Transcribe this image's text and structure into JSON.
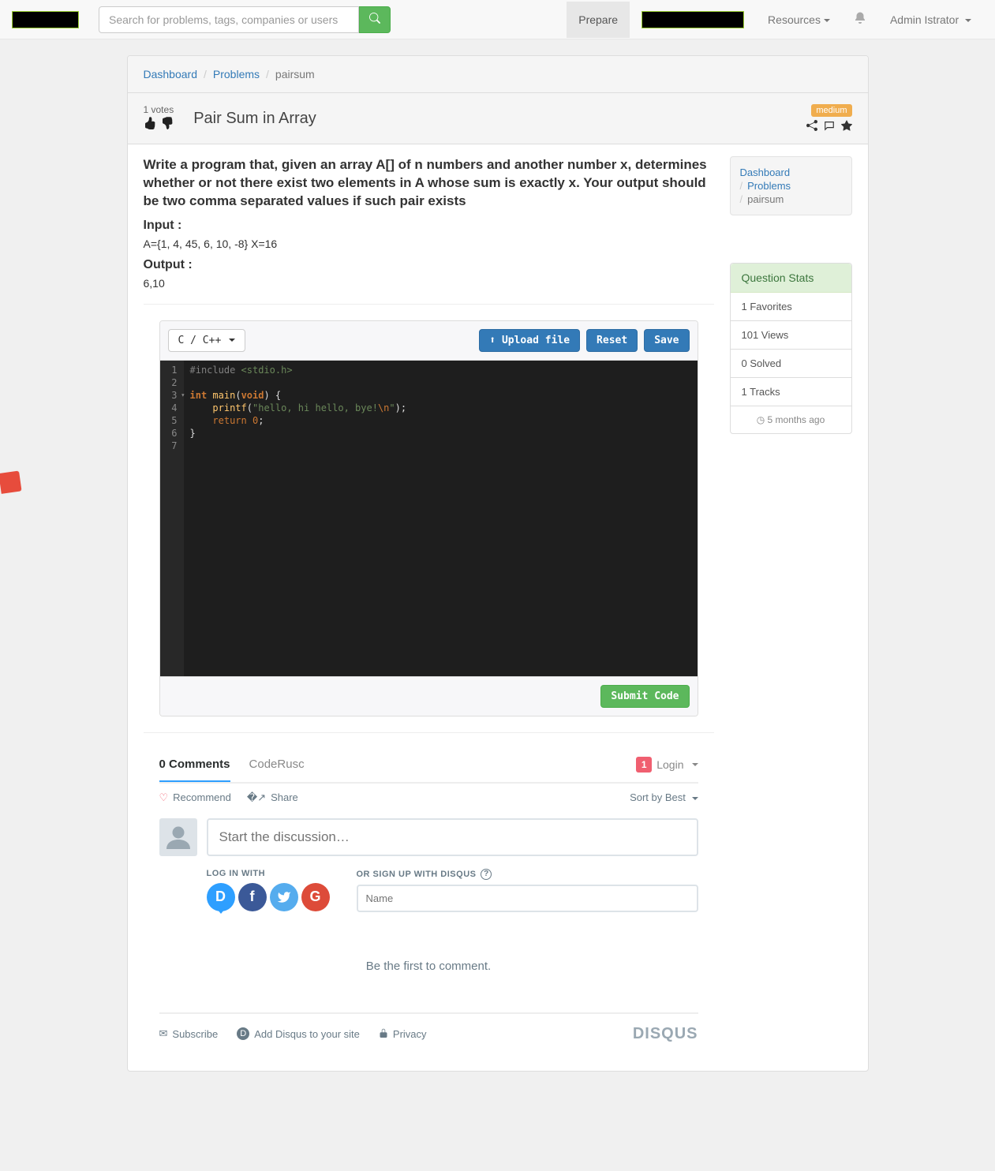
{
  "header": {
    "search_placeholder": "Search for problems, tags, companies or users",
    "nav_prepare": "Prepare",
    "nav_resources": "Resources",
    "nav_user": "Admin Istrator"
  },
  "breadcrumb": {
    "dashboard": "Dashboard",
    "problems": "Problems",
    "current": "pairsum"
  },
  "title": {
    "votes": "1 votes",
    "text": "Pair Sum in Array",
    "difficulty": "medium"
  },
  "problem": {
    "description": "Write a program that, given an array A[] of n numbers and another number x, determines whether or not there exist two elements in A whose sum is exactly x. Your output should be two comma separated values if such pair exists",
    "input_label": "Input :",
    "input_val": "A={1, 4, 45, 6, 10, -8} X=16",
    "output_label": "Output :",
    "output_val": "6,10"
  },
  "side_breadcrumb": {
    "dashboard": "Dashboard",
    "problems": "Problems",
    "current": "pairsum"
  },
  "stats": {
    "header": "Question Stats",
    "favorites": "1 Favorites",
    "views": "101 Views",
    "solved": "0 Solved",
    "tracks": "1 Tracks",
    "age": "5 months ago"
  },
  "editor": {
    "lang": "C / C++",
    "upload": "Upload file",
    "reset": "Reset",
    "save": "Save",
    "submit": "Submit Code",
    "code": {
      "l1a": "#include",
      "l1b": "<stdio.h>",
      "l3a": "int",
      "l3b": "main",
      "l3c": "(",
      "l3d": "void",
      "l3e": ") {",
      "l4a": "printf",
      "l4b": "(",
      "l4c": "\"hello, hi hello, bye!",
      "l4d": "\\n",
      "l4e": "\"",
      "l4f": ");",
      "l5a": "return",
      "l5b": "0",
      "l5c": ";",
      "l6": "}"
    }
  },
  "comments": {
    "count_tab": "0 Comments",
    "site": "CodeRusc",
    "login_count": "1",
    "login": "Login",
    "recommend": "Recommend",
    "share": "Share",
    "sort": "Sort by Best",
    "start_placeholder": "Start the discussion…",
    "login_with": "LOG IN WITH",
    "signup_with": "OR SIGN UP WITH DISQUS",
    "name_placeholder": "Name",
    "be_first": "Be the first to comment.",
    "subscribe": "Subscribe",
    "add_disqus": "Add Disqus to your site",
    "privacy": "Privacy",
    "logo": "DISQUS"
  }
}
